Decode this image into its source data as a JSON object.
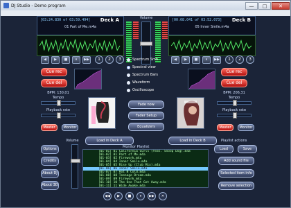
{
  "window": {
    "title": "DJ Studio - Demo program",
    "minimize": "—",
    "maximize": "□",
    "close": "✕"
  },
  "deck_a": {
    "label": "Deck A",
    "time": "[03:24.830 of 03:59.494]",
    "song": "01 Part of Me.m4a",
    "transport": [
      "◀",
      "▶",
      "■",
      "⏸",
      "▶▶"
    ],
    "numbers": [
      "1",
      "2",
      "3"
    ],
    "cue_rec": "Cue rec",
    "cue_del": "Cue del",
    "bpm": "BPM: 130,01",
    "tempo": "Tempo",
    "playback_rate": "Playback rate",
    "master": "Master",
    "monitor": "Monitor"
  },
  "deck_b": {
    "label": "Deck B",
    "time": "[00:08.041 of 03:52.073]",
    "song": "05 Inner Smile.m4a",
    "transport": [
      "◀",
      "▶",
      "■",
      "⏸",
      "▶▶"
    ],
    "numbers": [
      "1",
      "2",
      "3"
    ],
    "cue_rec": "Cue rec",
    "cue_del": "Cue del",
    "bpm": "BPM: 206,31",
    "tempo": "Tempo",
    "playback_rate": "Playback rate",
    "master": "Master",
    "monitor": "Monitor"
  },
  "center": {
    "volume": "Volume",
    "options": [
      "Spectrum Smh",
      "Spectral view",
      "Spectrum Bars",
      "Waveform",
      "Oscilloscope"
    ],
    "fade_now": "Fade now",
    "fader_setup": "Fader Setup",
    "equalizers": "Equalizers"
  },
  "left_panel": {
    "volume": "Volume",
    "buttons": [
      "Options",
      "Credits",
      "About DJ",
      "About 3D"
    ]
  },
  "load_a": "Load in Deck A",
  "load_b": "Load in Deck B",
  "monitor_playlist": {
    "title": "Monitor Playlist",
    "rows": [
      "[01-01] 01 California Gurls (feat. Snoop Dog).m4a",
      "[01-02] 01 Part of Me.m4a",
      "[01-03] 02 Firework.m4a",
      "[01-04] 04 Inner Smile.m4a",
      "[01-05] 05 Rise Up (Club Mix).m4a",
      "[01-06] 06 Inner Smile.m4a",
      "[01-07] 07 Hot N Cold.m4a",
      "[01-08] 08 Teenage Dream.m4a",
      "[01-09] 09 Firework.m4a",
      "[01-10] 10 The One That Got Away.m4a",
      "[01-11] 11 Wide Awake.m4a"
    ],
    "selected_index": 5
  },
  "playlist_actions": {
    "title": "Playlist actions",
    "load": "Load",
    "save": "Save",
    "add_sound": "Add sound file",
    "selected_info": "Selected item info",
    "remove": "Remove selection"
  },
  "bottom_controls": [
    "◀◀",
    "▶",
    "■",
    "⏸",
    "▶▶",
    "✕"
  ]
}
